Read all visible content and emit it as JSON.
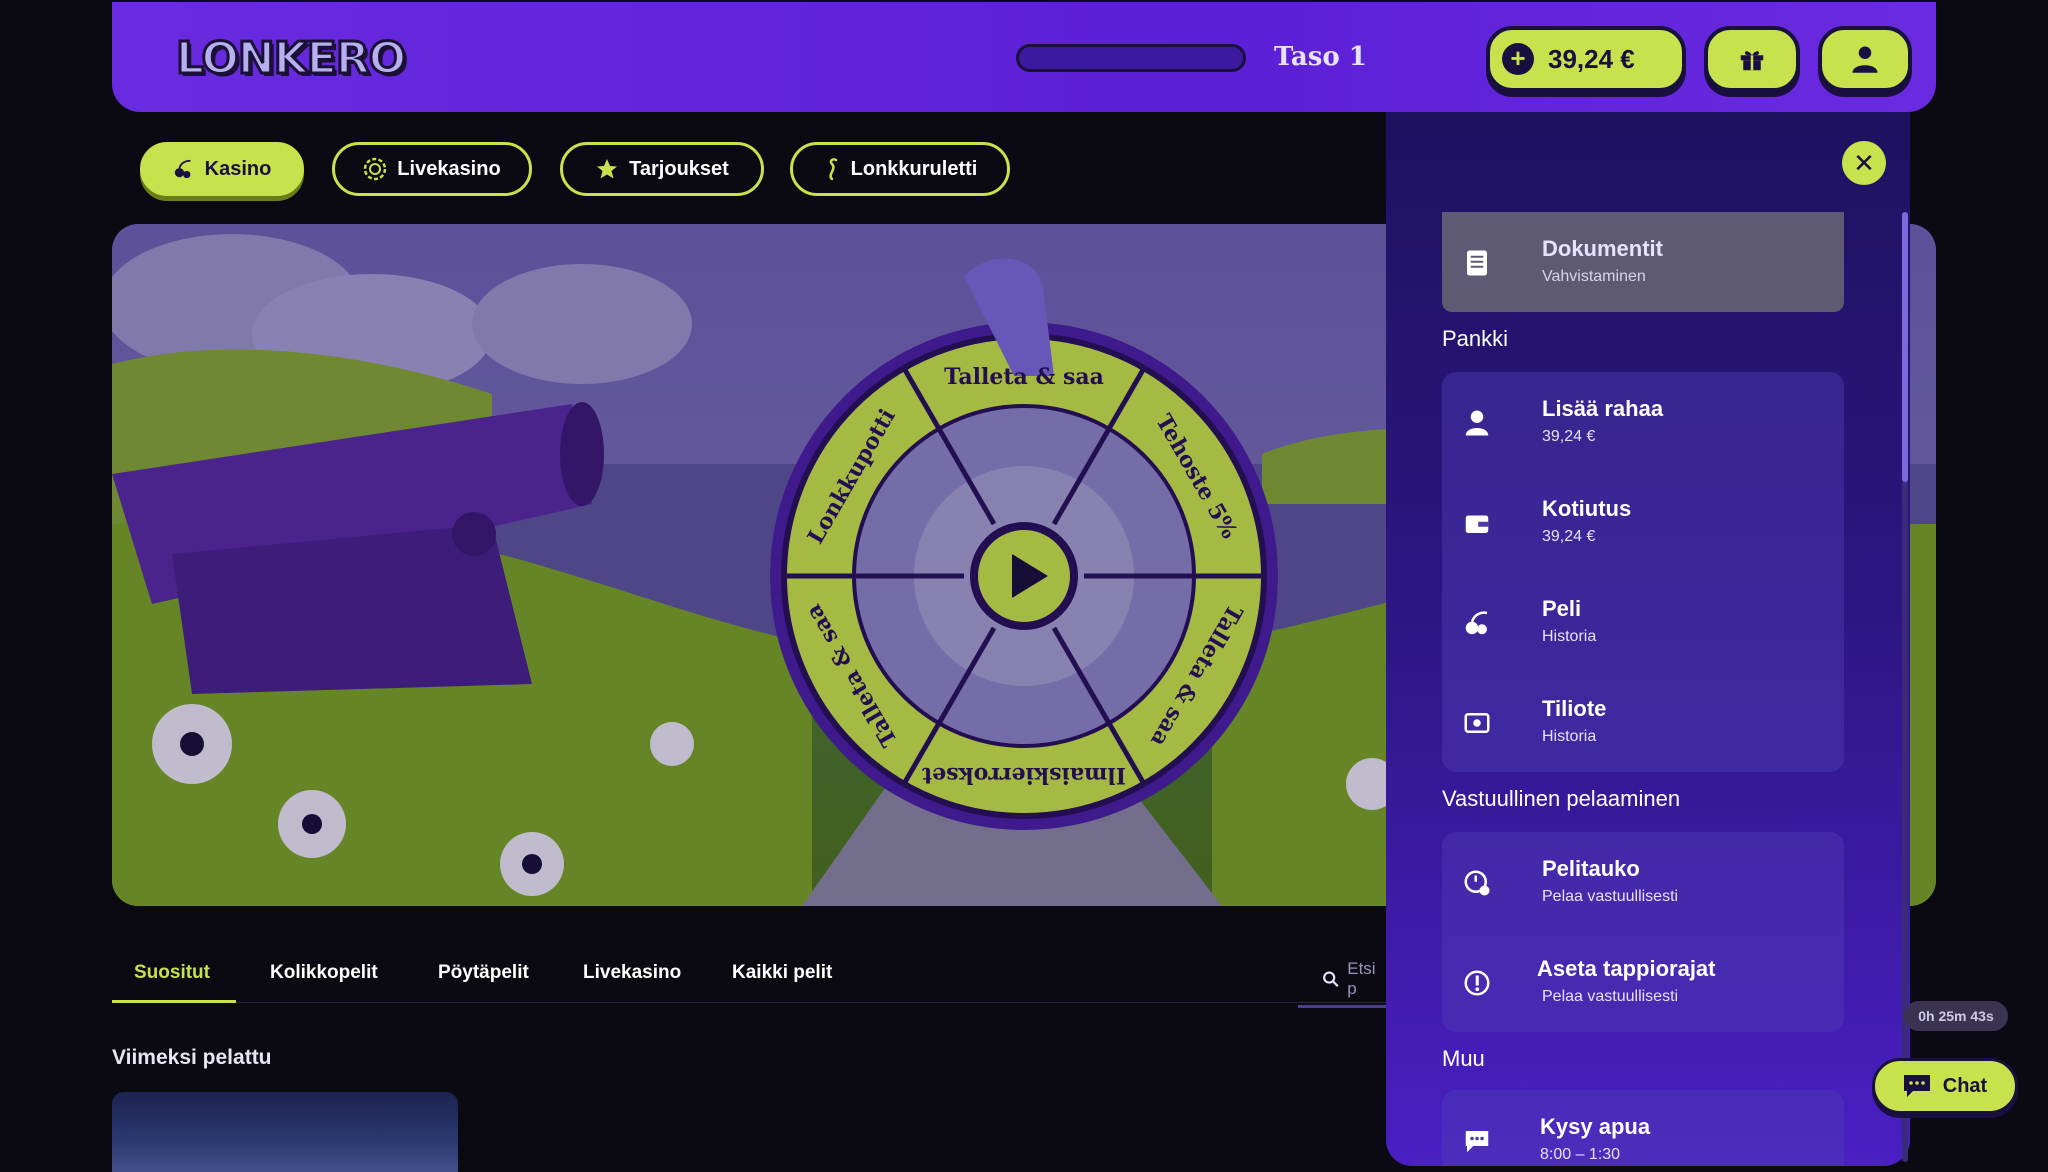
{
  "header": {
    "logo_text": "LONKERO",
    "level_label": "Taso 1",
    "level_progress": 0,
    "balance": "39,24 €"
  },
  "nav": {
    "chips": [
      {
        "label": "Kasino",
        "icon": "cherry-icon",
        "active": true
      },
      {
        "label": "Livekasino",
        "icon": "chip-icon",
        "active": false
      },
      {
        "label": "Tarjoukset",
        "icon": "star-icon",
        "active": false
      },
      {
        "label": "Lonkkuruletti",
        "icon": "tentacle-icon",
        "active": false
      }
    ]
  },
  "wheel": {
    "segments": [
      "Talleta & saa",
      "Tehoste 5%",
      "Talleta & saa",
      "Ilmaiskierrokset",
      "Talleta & saa",
      "Lonkkupotti"
    ],
    "center_icon": "play-icon"
  },
  "game_tabs": {
    "items": [
      "Suositut",
      "Kolikkopelit",
      "Pöytäpelit",
      "Livekasino",
      "Kaikki pelit"
    ],
    "active": "Suositut",
    "search_placeholder": "Etsi p"
  },
  "recent": {
    "title": "Viimeksi pelattu"
  },
  "drawer": {
    "documents": {
      "title": "Dokumentit",
      "subtitle": "Vahvistaminen",
      "icon": "document-icon"
    },
    "bank": {
      "label": "Pankki",
      "items": [
        {
          "title": "Lisää rahaa",
          "subtitle": "39,24 €",
          "icon": "user-icon"
        },
        {
          "title": "Kotiutus",
          "subtitle": "39,24 €",
          "icon": "wallet-icon"
        },
        {
          "title": "Peli",
          "subtitle": "Historia",
          "icon": "cherry-icon"
        },
        {
          "title": "Tiliote",
          "subtitle": "Historia",
          "icon": "statement-icon"
        }
      ]
    },
    "responsible": {
      "label": "Vastuullinen pelaaminen",
      "items": [
        {
          "title": "Pelitauko",
          "subtitle": "Pelaa vastuullisesti",
          "icon": "pause-clock-icon"
        },
        {
          "title": "Aseta tappiorajat",
          "subtitle": "Pelaa vastuullisesti",
          "icon": "limit-icon"
        }
      ]
    },
    "other": {
      "label": "Muu",
      "items": [
        {
          "title": "Kysy apua",
          "subtitle": "8:00 – 1:30",
          "icon": "chat-bubble-icon"
        }
      ]
    }
  },
  "timer": "0h 25m 43s",
  "chat": {
    "label": "Chat"
  },
  "colors": {
    "accent": "#c7e24c",
    "purple": "#5b1fd6",
    "dark": "#1a1040"
  }
}
